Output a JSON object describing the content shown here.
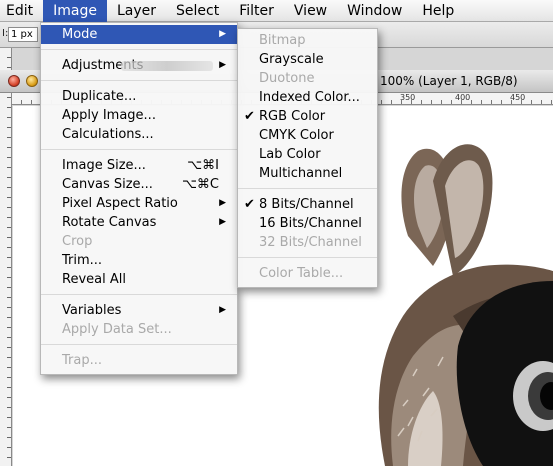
{
  "menubar": {
    "items": [
      "Edit",
      "Image",
      "Layer",
      "Select",
      "Filter",
      "View",
      "Window",
      "Help"
    ],
    "active": "Image"
  },
  "options_bar": {
    "label": "I:",
    "input_value": "1 px"
  },
  "document": {
    "title": "100% (Layer 1, RGB/8)",
    "ruler_labels": [
      "350",
      "400",
      "450"
    ]
  },
  "image_menu": {
    "mode": "Mode",
    "adjustments": "Adjustments",
    "duplicate": "Duplicate...",
    "apply_image": "Apply Image...",
    "calculations": "Calculations...",
    "image_size": "Image Size...",
    "image_size_shortcut": "⌥⌘I",
    "canvas_size": "Canvas Size...",
    "canvas_size_shortcut": "⌥⌘C",
    "pixel_aspect_ratio": "Pixel Aspect Ratio",
    "rotate_canvas": "Rotate Canvas",
    "crop": "Crop",
    "trim": "Trim...",
    "reveal_all": "Reveal All",
    "variables": "Variables",
    "apply_data_set": "Apply Data Set...",
    "trap": "Trap..."
  },
  "mode_submenu": {
    "bitmap": "Bitmap",
    "grayscale": "Grayscale",
    "duotone": "Duotone",
    "indexed_color": "Indexed Color...",
    "rgb_color": "RGB Color",
    "cmyk_color": "CMYK Color",
    "lab_color": "Lab Color",
    "multichannel": "Multichannel",
    "bits8": "8 Bits/Channel",
    "bits16": "16 Bits/Channel",
    "bits32": "32 Bits/Channel",
    "color_table": "Color Table...",
    "check_mark": "✔"
  },
  "icons": {
    "submenu_arrow": "▶"
  },
  "colors": {
    "highlight": "#2f57b5"
  }
}
